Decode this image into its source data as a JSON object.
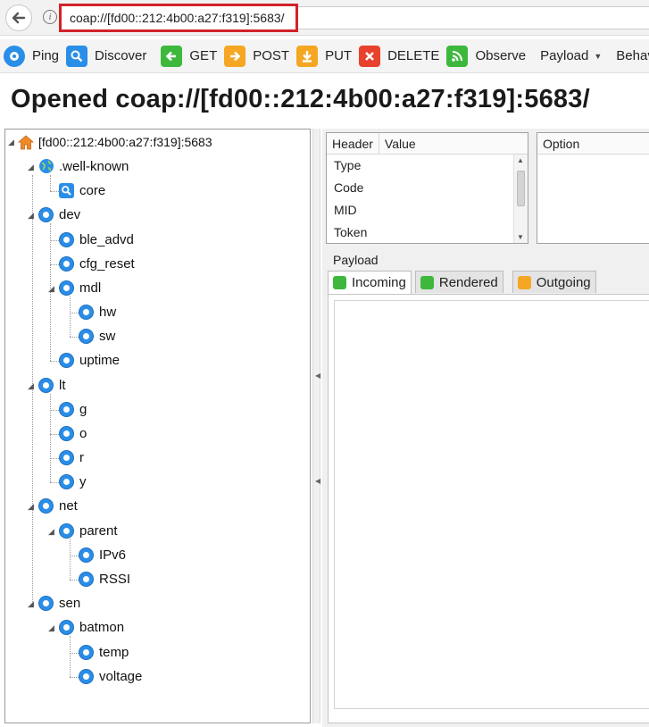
{
  "browser": {
    "url": "coap://[fd00::212:4b00:a27:f319]:5683/",
    "back_icon": "arrow-left-icon",
    "info_icon": "info-icon"
  },
  "toolbar": {
    "ping": "Ping",
    "discover": "Discover",
    "get": "GET",
    "post": "POST",
    "put": "PUT",
    "delete": "DELETE",
    "observe": "Observe",
    "payload": "Payload",
    "behavior": "Behavior"
  },
  "title": "Opened coap://[fd00::212:4b00:a27:f319]:5683/",
  "tree": {
    "root": "[fd00::212:4b00:a27:f319]:5683",
    "wellknown": ".well-known",
    "core": "core",
    "dev": "dev",
    "ble_advd": "ble_advd",
    "cfg_reset": "cfg_reset",
    "mdl": "mdl",
    "hw": "hw",
    "sw": "sw",
    "uptime": "uptime",
    "lt": "lt",
    "g": "g",
    "o": "o",
    "r": "r",
    "y": "y",
    "net": "net",
    "parent": "parent",
    "ipv6": "IPv6",
    "rssi": "RSSI",
    "sen": "sen",
    "batmon": "batmon",
    "temp": "temp",
    "voltage": "voltage"
  },
  "headers": {
    "col_header": "Header",
    "col_value": "Value",
    "rows": [
      "Type",
      "Code",
      "MID",
      "Token"
    ]
  },
  "options": {
    "col_option": "Option"
  },
  "payload": {
    "label": "Payload",
    "tab_incoming": "Incoming",
    "tab_rendered": "Rendered",
    "tab_outgoing": "Outgoing"
  },
  "colors": {
    "accent_red": "#d2232a",
    "resource_blue": "#2a8ee8",
    "green": "#3db83d",
    "orange": "#f5a623",
    "delete_red": "#e8412c"
  }
}
